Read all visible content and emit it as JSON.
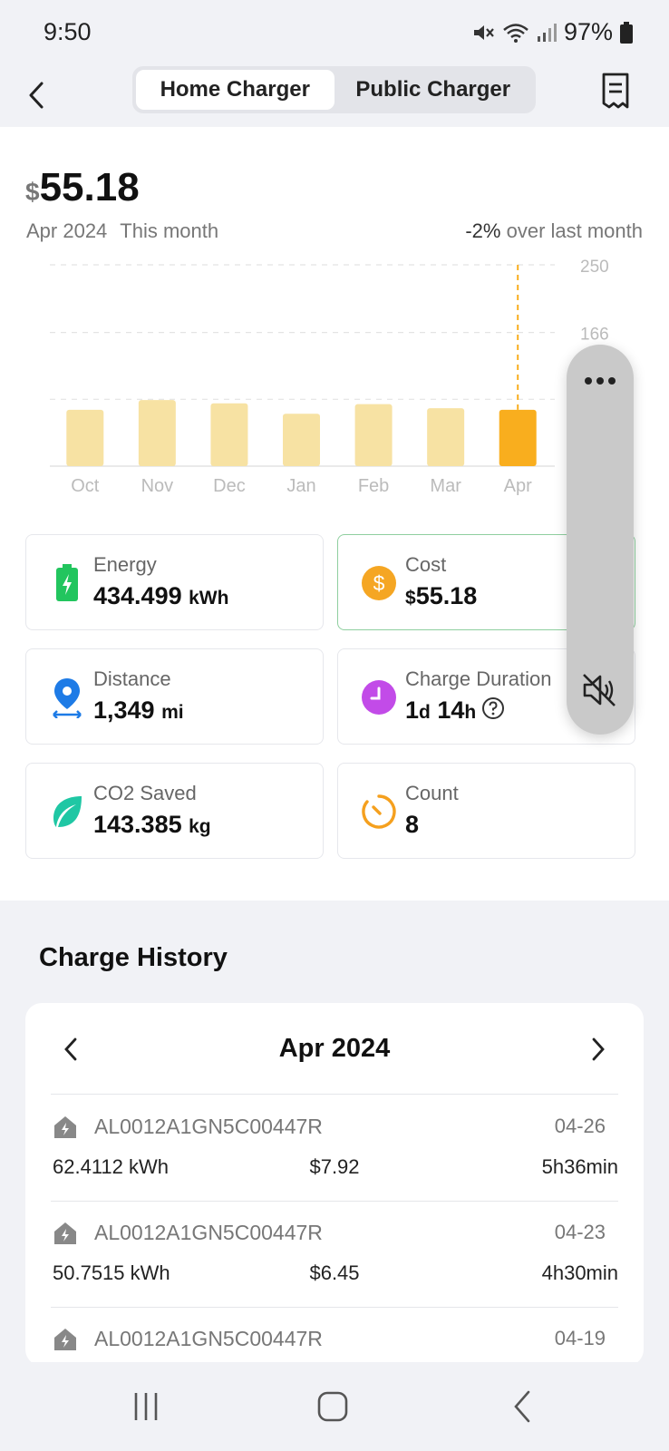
{
  "status_bar": {
    "time": "9:50",
    "battery": "97%",
    "icons": [
      "mute-icon",
      "wifi-icon",
      "signal-icon",
      "battery-icon"
    ]
  },
  "header": {
    "tabs": [
      {
        "label": "Home Charger",
        "active": true
      },
      {
        "label": "Public Charger",
        "active": false
      }
    ],
    "icons": {
      "back": "chevron-left-icon",
      "receipt": "receipt-icon"
    }
  },
  "summary": {
    "currency": "$",
    "amount": "55.18",
    "month": "Apr 2024",
    "period_label": "This month",
    "change_pct": "-2%",
    "change_suffix": "over last month"
  },
  "chart_data": {
    "type": "bar",
    "categories": [
      "Oct",
      "Nov",
      "Dec",
      "Jan",
      "Feb",
      "Mar",
      "Apr"
    ],
    "values": [
      70,
      82,
      78,
      65,
      77,
      72,
      70
    ],
    "highlighted": "Apr",
    "y_ticks": [
      250,
      166
    ],
    "ylim": [
      0,
      250
    ],
    "grid": true,
    "colors": {
      "bar": "#f7e2a3",
      "highlight": "#f9ae1e",
      "grid": "#e4e4e4",
      "axis_text": "#bbbbbb"
    }
  },
  "stats": {
    "energy": {
      "label": "Energy",
      "value": "434.499",
      "unit": "kWh",
      "icon": "battery-charging-icon",
      "color": "#22c55e"
    },
    "cost": {
      "label": "Cost",
      "currency": "$",
      "value": "55.18",
      "icon": "dollar-coin-icon",
      "color": "#f5a623"
    },
    "distance": {
      "label": "Distance",
      "value": "1,349",
      "unit": "mi",
      "icon": "location-pin-icon",
      "color": "#1e7be6"
    },
    "duration": {
      "label": "Charge Duration",
      "days": "1",
      "days_unit": "d",
      "hours": "14",
      "hours_unit": "h",
      "icon": "clock-icon",
      "color": "#c24be8"
    },
    "co2": {
      "label": "CO2 Saved",
      "value": "143.385",
      "unit": "kg",
      "icon": "leaf-icon",
      "color": "#1fc7a4"
    },
    "count": {
      "label": "Count",
      "value": "8",
      "icon": "timer-icon",
      "color": "#f5a01e"
    }
  },
  "float_panel": {
    "icons": [
      "more-icon",
      "volume-mute-icon"
    ]
  },
  "history": {
    "title": "Charge History",
    "month": "Apr 2024",
    "records": [
      {
        "id": "AL0012A1GN5C00447R",
        "date": "04-26",
        "energy": "62.4112 kWh",
        "cost": "$7.92",
        "duration": "5h36min"
      },
      {
        "id": "AL0012A1GN5C00447R",
        "date": "04-23",
        "energy": "50.7515 kWh",
        "cost": "$6.45",
        "duration": "4h30min"
      },
      {
        "id": "AL0012A1GN5C00447R",
        "date": "04-19",
        "energy": "",
        "cost": "",
        "duration": ""
      }
    ]
  },
  "nav_bar": {
    "icons": [
      "recents-icon",
      "home-icon",
      "back-icon"
    ]
  }
}
